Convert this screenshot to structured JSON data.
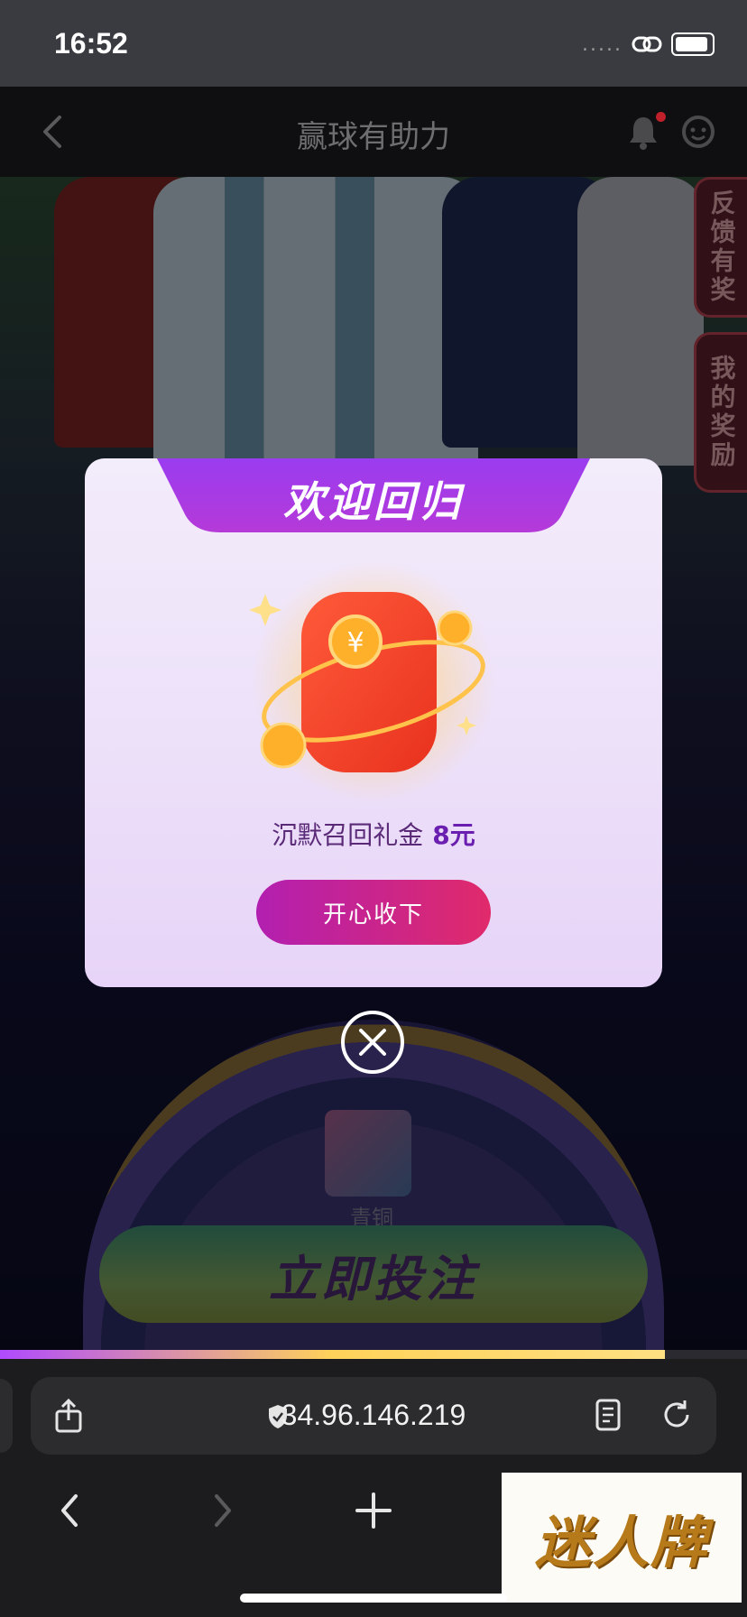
{
  "status_bar": {
    "time": "16:52",
    "signal": "....."
  },
  "header": {
    "title": "赢球有助力"
  },
  "side_tabs": [
    {
      "label": "反馈有奖"
    },
    {
      "label": "我的奖励"
    }
  ],
  "background": {
    "wheel_label": "青铜",
    "bet_button": "立即投注"
  },
  "modal": {
    "banner": "欢迎回归",
    "reward_label": "沉默召回礼金",
    "reward_amount": "8元",
    "accept_button": "开心收下"
  },
  "browser": {
    "url": "34.96.146.219"
  },
  "watermark": {
    "text": "迷人牌"
  },
  "colors": {
    "accent_purple": "#6a1fb0",
    "button_start": "#b21fb0",
    "button_end": "#e02a6a",
    "progress": "#ffd25a"
  }
}
